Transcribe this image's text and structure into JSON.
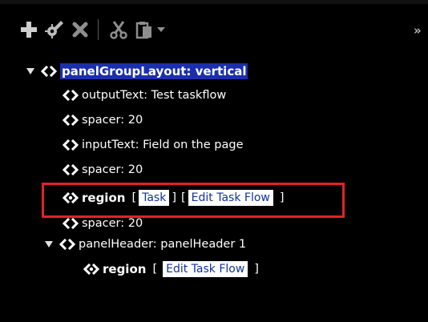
{
  "toolbar": {
    "buttons": [
      {
        "name": "add",
        "icon": "plus-icon",
        "enabled": true
      },
      {
        "name": "edit",
        "icon": "pencil-gear-icon",
        "enabled": true
      },
      {
        "name": "delete",
        "icon": "close-icon",
        "enabled": false
      },
      {
        "name": "cut",
        "icon": "scissors-icon",
        "enabled": false
      },
      {
        "name": "paste",
        "icon": "clipboard-icon",
        "enabled": false
      },
      {
        "name": "paste-menu",
        "icon": "chevron-down-icon",
        "enabled": false
      }
    ],
    "overflow_label": "»"
  },
  "tree": {
    "root": {
      "label": "panelGroupLayout: vertical",
      "expanded": true,
      "children": [
        {
          "label": "outputText: Test taskflow"
        },
        {
          "label": "spacer: 20"
        },
        {
          "label": "inputText: Field on the page"
        },
        {
          "label": "spacer: 20"
        },
        {
          "label": "region",
          "bracket_open_1": "[",
          "link_1": "Task",
          "bracket_close_1": "]",
          "bracket_open_2": "[",
          "link_2": "Edit Task Flow",
          "bracket_close_2": "]"
        },
        {
          "label": "spacer: 20"
        },
        {
          "label": "panelHeader: panelHeader 1",
          "expanded": true,
          "children": [
            {
              "label": "region",
              "bracket_open": "[",
              "link": "Edit Task Flow",
              "bracket_close": "]"
            }
          ]
        }
      ]
    }
  },
  "colors": {
    "background": "#000000",
    "selected_bg": "#1b2fae",
    "link_text": "#12339c",
    "highlight_border": "#e3212c",
    "icon_gray": "#bdbdbd"
  }
}
